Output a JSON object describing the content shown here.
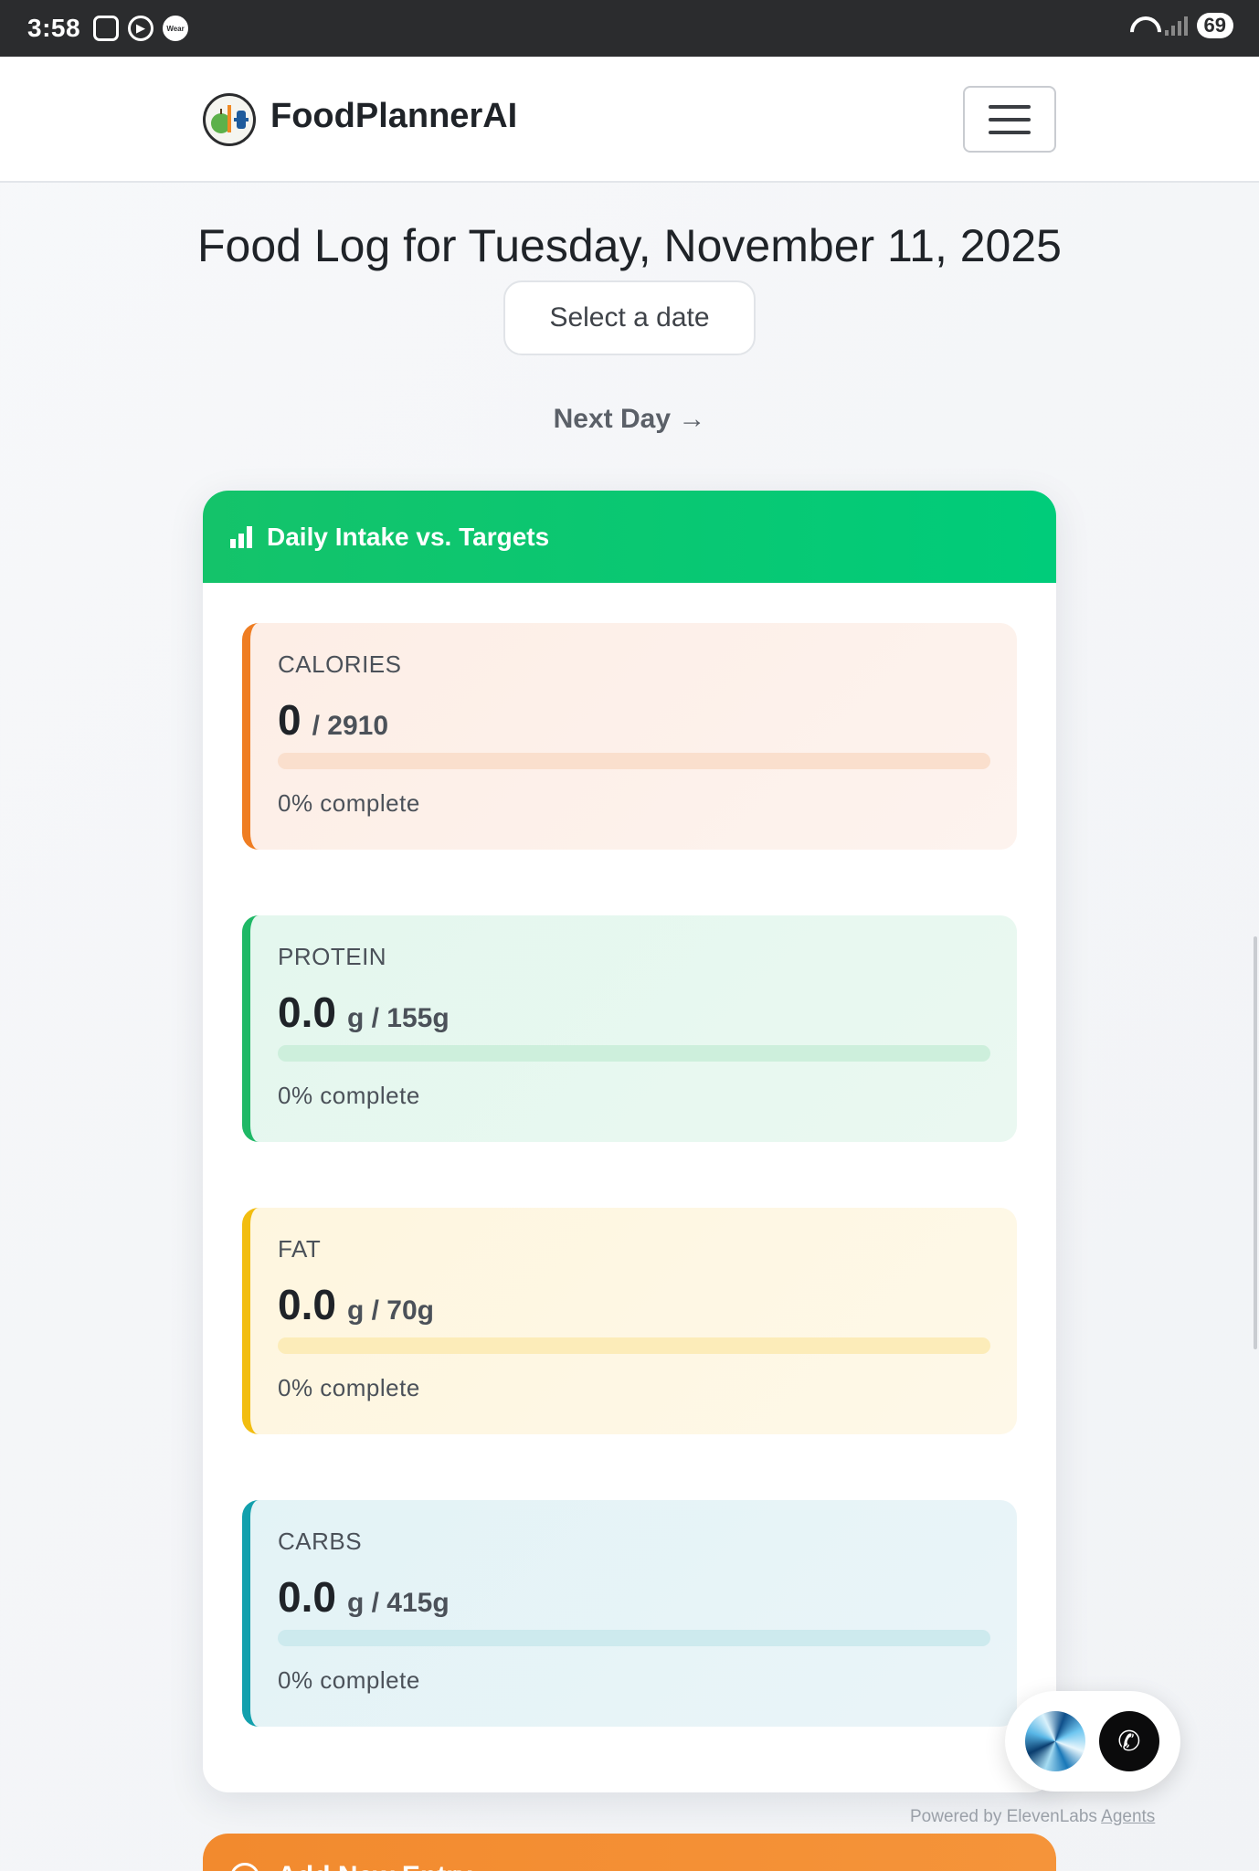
{
  "status_bar": {
    "time": "3:58",
    "battery": "69",
    "icons": [
      "screenshot-icon",
      "play-icon",
      "wear-icon",
      "wifi-icon",
      "signal-icon"
    ]
  },
  "navbar": {
    "brand": "FoodPlannerAI",
    "menu_icon": "hamburger-icon"
  },
  "page": {
    "title": "Food Log for Tuesday, November 11, 2025",
    "date_picker_placeholder": "Select a date",
    "next_day_label": "Next Day →"
  },
  "intake_card": {
    "title": "Daily Intake vs. Targets",
    "icon": "bar-chart-icon",
    "macros": [
      {
        "label": "CALORIES",
        "value": "0",
        "target": "/ 2910",
        "progress": 0,
        "status": "0% complete",
        "color": "#ef7d22"
      },
      {
        "label": "PROTEIN",
        "value": "0.0",
        "target": "g / 155g",
        "progress": 0,
        "status": "0% complete",
        "color": "#1fb866"
      },
      {
        "label": "FAT",
        "value": "0.0",
        "target": "g / 70g",
        "progress": 0,
        "status": "0% complete",
        "color": "#f2bd10"
      },
      {
        "label": "CARBS",
        "value": "0.0",
        "target": "g / 415g",
        "progress": 0,
        "status": "0% complete",
        "color": "#12a0ad"
      }
    ]
  },
  "add_card": {
    "title": "Add New Entry"
  },
  "voice_widget": {
    "powered_by": "Powered by ElevenLabs",
    "powered_link": "Agents"
  },
  "colors": {
    "header_green": "#00cc7a",
    "accent_orange": "#f28a2e"
  }
}
